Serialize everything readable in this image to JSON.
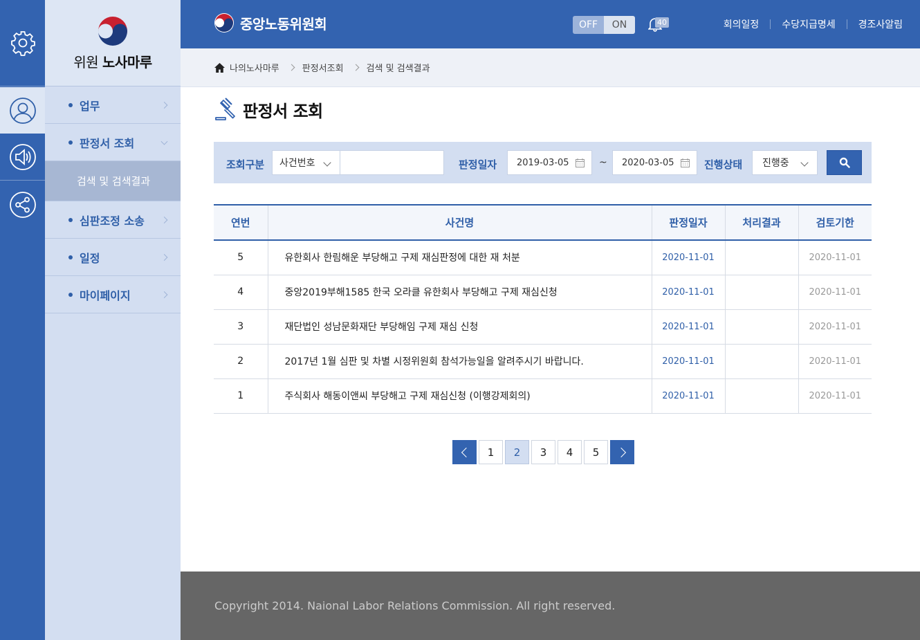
{
  "rail": {
    "icons": [
      "gear-icon",
      "user-icon",
      "speaker-icon",
      "share-icon"
    ]
  },
  "logo": {
    "prefix": "위원",
    "name": "노사마루"
  },
  "sidebar": {
    "items": [
      {
        "label": "업무"
      },
      {
        "label": "판정서 조회"
      },
      {
        "label": "심판조정 소송"
      },
      {
        "label": "일정"
      },
      {
        "label": "마이페이지"
      }
    ],
    "subitem": "검색 및 검색결과"
  },
  "header": {
    "brand": "중앙노동위원회",
    "toggle_off": "OFF",
    "toggle_on": "ON",
    "notification_count": "40",
    "links": [
      "회의일정",
      "수당지급명세",
      "경조사알림"
    ]
  },
  "breadcrumb": [
    "나의노사마루",
    "판정서조회",
    "검색 및 검색결과"
  ],
  "page_title": "판정서 조회",
  "search": {
    "type_label": "조회구분",
    "type_value": "사건번호",
    "keyword": "",
    "date_label": "판정일자",
    "date_from": "2019-03-05",
    "tilde": "~",
    "date_to": "2020-03-05",
    "status_label": "진행상태",
    "status_value": "진행중"
  },
  "table": {
    "headers": [
      "연번",
      "사건명",
      "판정일자",
      "처리결과",
      "검토기한"
    ],
    "rows": [
      {
        "no": "5",
        "title": "유한회사 한림해운 부당해고 구제 재심판정에 대한 재 처분",
        "date": "2020-11-01",
        "result": "",
        "deadline": "2020-11-01"
      },
      {
        "no": "4",
        "title": "중앙2019부해1585 한국 오라클 유한회사 부당해고 구제 재심신청",
        "date": "2020-11-01",
        "result": "",
        "deadline": "2020-11-01"
      },
      {
        "no": "3",
        "title": "재단법인 성남문화재단 부당해임 구제 재심 신청",
        "date": "2020-11-01",
        "result": "",
        "deadline": "2020-11-01"
      },
      {
        "no": "2",
        "title": "2017년 1월 심판 및 차별 시정위원회 참석가능일을 알려주시기 바랍니다.",
        "date": "2020-11-01",
        "result": "",
        "deadline": "2020-11-01"
      },
      {
        "no": "1",
        "title": "주식회사 해동이앤씨 부당해고 구제 재심신청 (이행강제회의)",
        "date": "2020-11-01",
        "result": "",
        "deadline": "2020-11-01"
      }
    ]
  },
  "pagination": {
    "pages": [
      "1",
      "2",
      "3",
      "4",
      "5"
    ],
    "current": "2"
  },
  "footer": {
    "copyright": "Copyright 2014. Naional Labor Relations Commission. All right reserved."
  },
  "colors": {
    "primary": "#3363b0",
    "sidebar_bg": "#d3def1",
    "footer_bg": "#666666"
  }
}
